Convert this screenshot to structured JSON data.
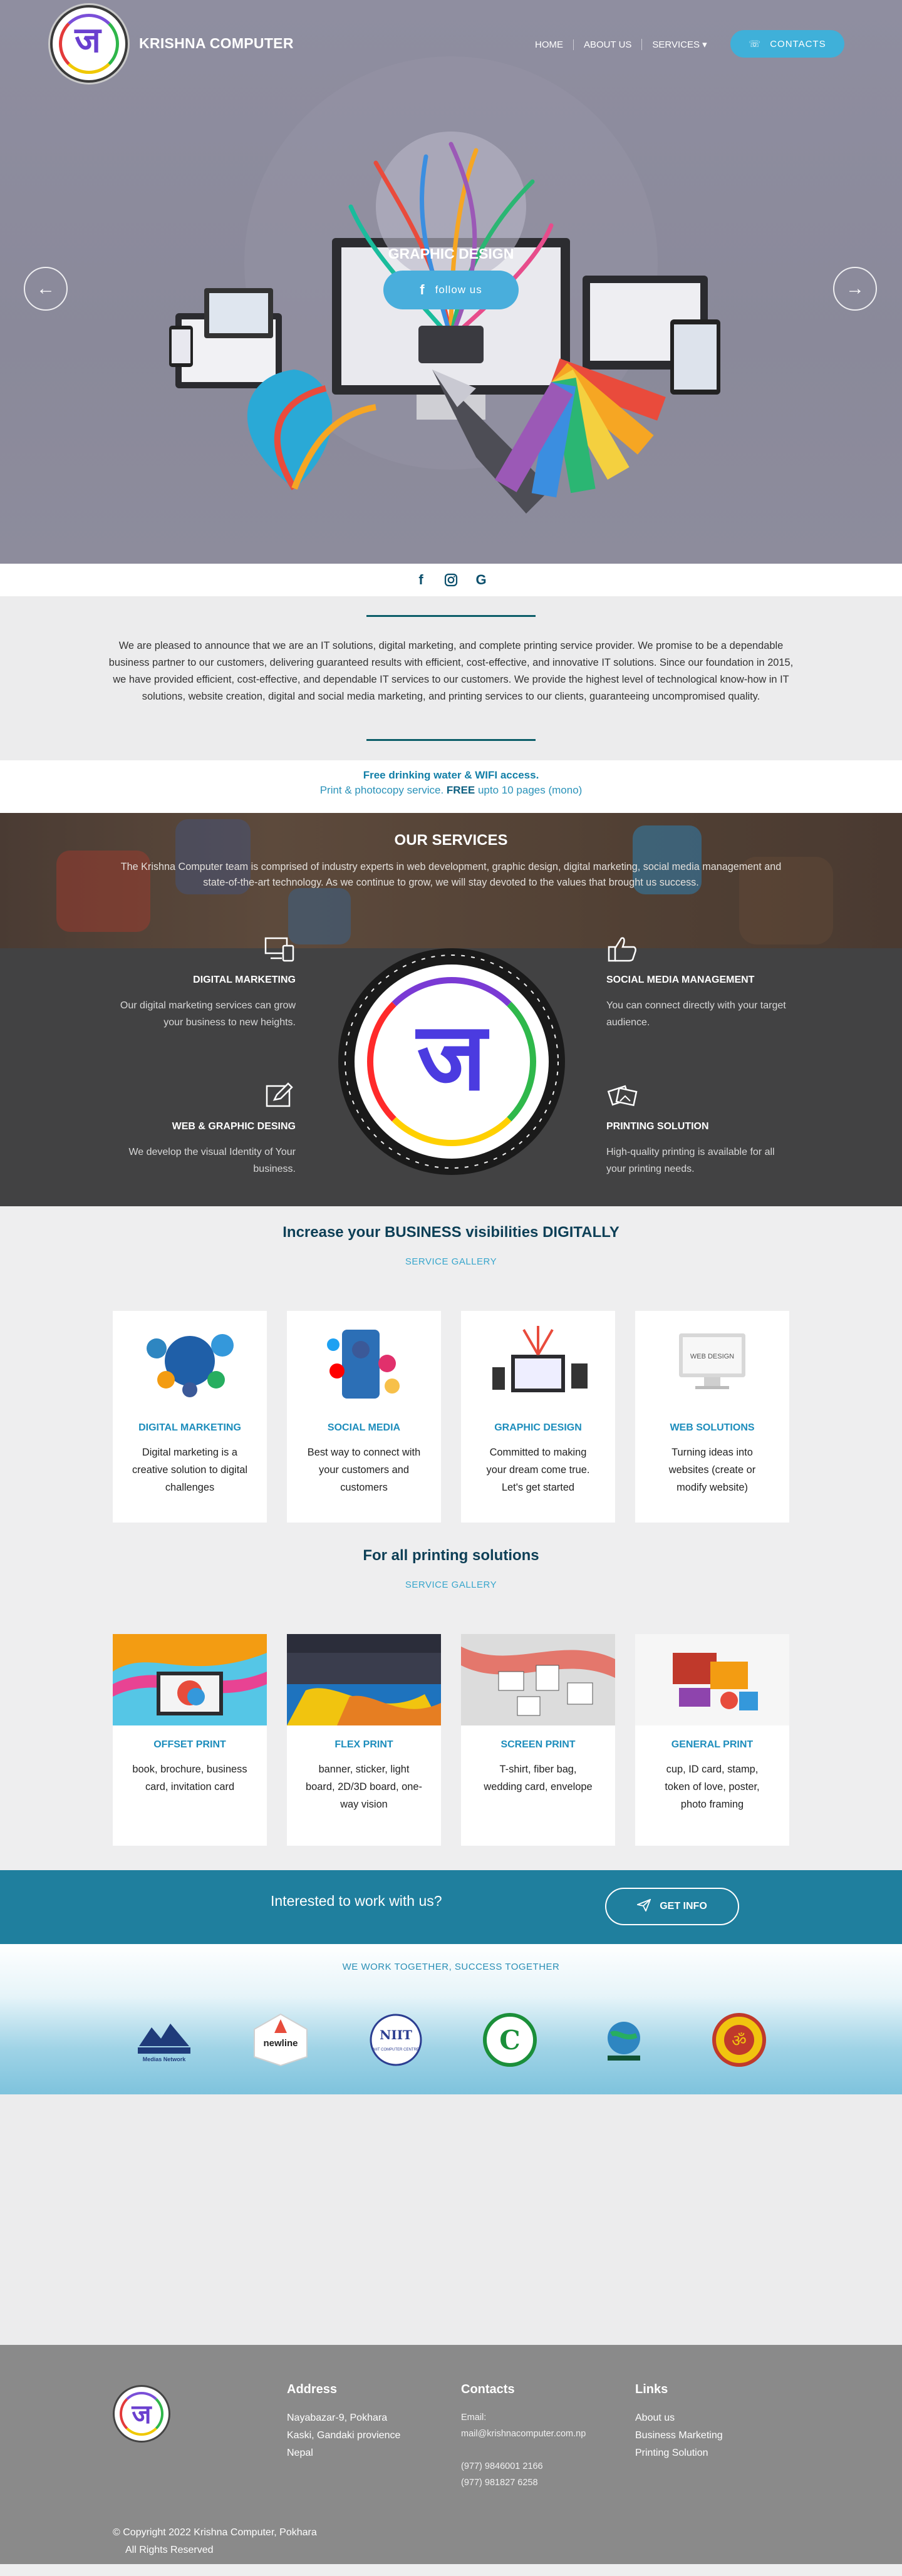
{
  "brand": {
    "name": "KRISHNA COMPUTER"
  },
  "nav": {
    "items": [
      "HOME",
      "ABOUT US",
      "SERVICES ▾"
    ],
    "contacts": "CONTACTS"
  },
  "hero": {
    "title": "GRAPHIC DESIGN",
    "button": "follow us",
    "prev_icon": "arrow-left-icon",
    "next_icon": "arrow-right-icon"
  },
  "social_icons": [
    "facebook-icon",
    "instagram-icon",
    "google-icon"
  ],
  "about": {
    "text": "We are pleased to announce that we are an IT solutions, digital marketing, and complete printing service provider. We promise to be a dependable business partner to our customers, delivering guaranteed results with efficient, cost-effective, and innovative IT solutions. Since our foundation in 2015, we have provided efficient, cost-effective, and dependable IT services to our customers. We provide the highest level of technological know-how in IT solutions, website creation, digital and social media marketing, and printing services to our clients, guaranteeing uncompromised quality."
  },
  "free": {
    "line1": "Free drinking water & WIFI access.",
    "line2_pre": "Print & photocopy service. ",
    "line2_bold": "FREE",
    "line2_post": " upto 10 pages (mono)"
  },
  "our_services": {
    "title": "OUR SERVICES",
    "intro": "The Krishna Computer team is comprised of industry experts in web development, graphic design, digital marketing, social media management and state-of-the-art technology. As we continue to grow, we will stay devoted to the values that brought us success.",
    "items": [
      {
        "title": "DIGITAL MARKETING",
        "text": "Our digital marketing services can grow your business to new heights.",
        "icon": "devices-icon"
      },
      {
        "title": "SOCIAL MEDIA MANAGEMENT",
        "text": "You can connect directly with your target audience.",
        "icon": "thumbs-up-icon"
      },
      {
        "title": "WEB & GRAPHIC DESING",
        "text": "We develop the visual Identity of Your business.",
        "icon": "edit-icon"
      },
      {
        "title": "PRINTING SOLUTION",
        "text": "High-quality printing is available for all your printing needs.",
        "icon": "photos-icon"
      }
    ]
  },
  "digital": {
    "title": "Increase your BUSINESS visibilities DIGITALLY",
    "sub": "SERVICE GALLERY",
    "cards": [
      {
        "title": "DIGITAL MARKETING",
        "text": "Digital marketing is a creative solution to digital challenges"
      },
      {
        "title": "SOCIAL MEDIA",
        "text": "Best way to connect with your customers and customers"
      },
      {
        "title": "GRAPHIC DESIGN",
        "text": "Committed to making your dream come true. Let's get started"
      },
      {
        "title": "WEB SOLUTIONS",
        "text": "Turning ideas into websites (create or modify website)"
      }
    ]
  },
  "printing": {
    "title": "For all printing solutions",
    "sub": "SERVICE GALLERY",
    "cards": [
      {
        "title": "OFFSET PRINT",
        "text": "book, brochure, business card, invitation card"
      },
      {
        "title": "FLEX PRINT",
        "text": "banner, sticker, light board, 2D/3D board, one-way vision"
      },
      {
        "title": "SCREEN PRINT",
        "text": "T-shirt, fiber bag, wedding card, envelope"
      },
      {
        "title": "GENERAL PRINT",
        "text": "cup, ID card, stamp, token of love, poster, photo framing"
      }
    ]
  },
  "cta": {
    "text": "Interested to work with us?",
    "button": "GET INFO"
  },
  "partners": {
    "caption": "WE WORK TOGETHER, SUCCESS TOGETHER",
    "logos": [
      {
        "label": "Medias Network"
      },
      {
        "label": "newline"
      },
      {
        "label": "NIIT COMPUTER CENTRE"
      },
      {
        "label": ""
      },
      {
        "label": ""
      },
      {
        "label": ""
      }
    ]
  },
  "footer": {
    "address_title": "Address",
    "address": [
      "Nayabazar-9, Pokhara",
      "Kaski, Gandaki provience",
      "Nepal"
    ],
    "contacts_title": "Contacts",
    "email_label": "Email:",
    "email": "mail@krishnacomputer.com.np",
    "phones": [
      "(977) 9846001 2166",
      "(977) 981827 6258"
    ],
    "links_title": "Links",
    "links": [
      "About us",
      "Business Marketing",
      "Printing Solution"
    ],
    "copyright": "© Copyright 2022 Krishna Computer, Pokhara",
    "rights": "All Rights Reserved"
  },
  "colors": {
    "accent": "#3fb0d9",
    "dark_teal": "#0d3f56",
    "cta": "#1f7f9e"
  }
}
